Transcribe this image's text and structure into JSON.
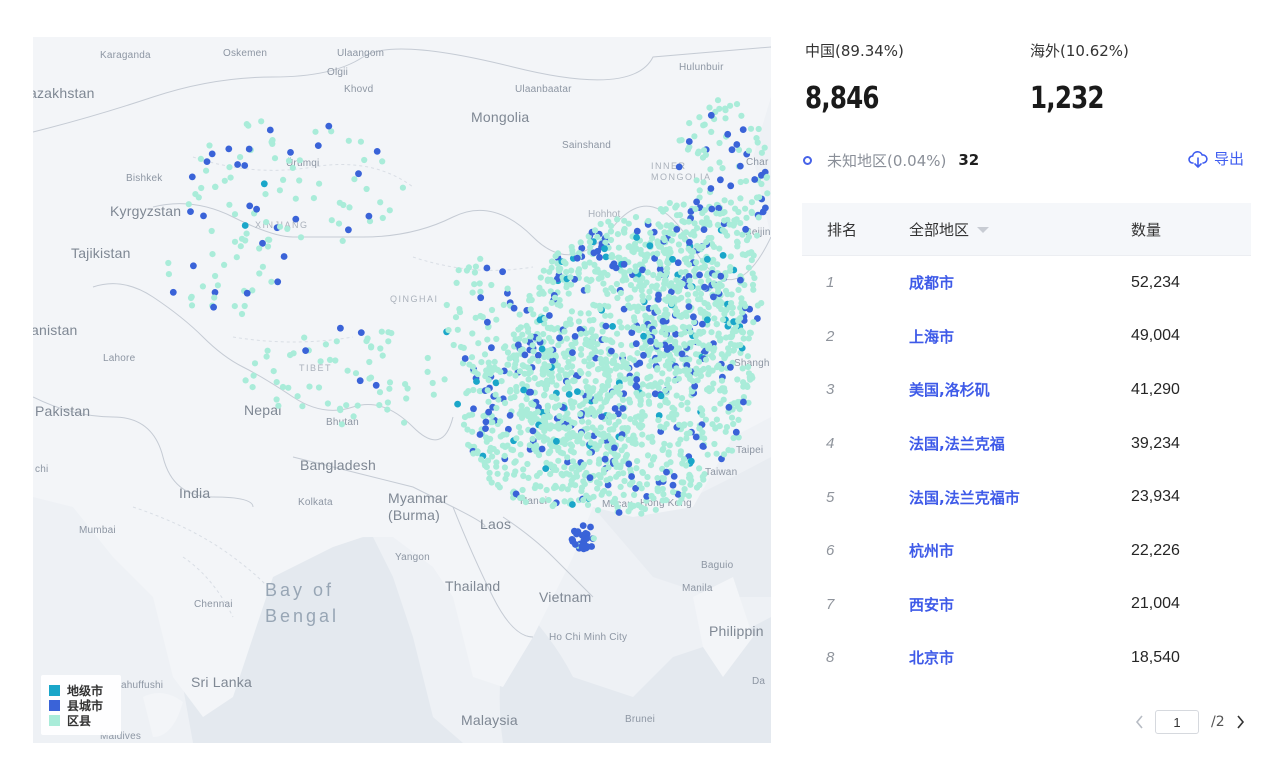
{
  "map": {
    "countries": [
      {
        "label": "azakhstan",
        "cls": "country"
      },
      {
        "label": "Kyrgyzstan",
        "cls": "country"
      },
      {
        "label": "Tajikistan",
        "cls": "country"
      },
      {
        "label": "Mongolia",
        "cls": "country"
      },
      {
        "label": "anistan",
        "cls": "country"
      },
      {
        "label": "Pakistan",
        "cls": "country"
      },
      {
        "label": "Nepal",
        "cls": "country"
      },
      {
        "label": "India",
        "cls": "country"
      },
      {
        "label": "Bangladesh",
        "cls": "country"
      },
      {
        "label": "Myanmar\n(Burma)",
        "cls": "country"
      },
      {
        "label": "Laos",
        "cls": "country"
      },
      {
        "label": "Thailand",
        "cls": "country"
      },
      {
        "label": "Vietnam",
        "cls": "country"
      },
      {
        "label": "Sri Lanka",
        "cls": "country"
      },
      {
        "label": "Malaysia",
        "cls": "country"
      },
      {
        "label": "Philippin",
        "cls": "country"
      }
    ],
    "cities": [
      "Karaganda",
      "Oskemen",
      "Ulaangom",
      "Olgii",
      "Khovd",
      "Ulaanbaatar",
      "Hulunbuir",
      "Sainshand",
      "Bishkek",
      "Ürümqi",
      "Lahore",
      "Bhutan",
      "Kolkata",
      "Mumbai",
      "Chennai",
      "Yangon",
      "Hanoi",
      "Macau",
      "Hong Kong",
      "Taipei",
      "Taiwan",
      "Baguio",
      "Manila",
      "Ho Chi Minh City",
      "Brunei",
      "Shangh",
      "Beijing",
      "ahuffushi",
      "Maldives",
      "Da",
      "Char",
      "chi"
    ],
    "regions": [
      "XINJIANG",
      "QINGHAI",
      "TIBET",
      "INNER MONGOLIA",
      "Hohhot"
    ],
    "sea": "Bay of\nBengal",
    "legend": [
      {
        "label": "地级市",
        "color": "#1aa6c9"
      },
      {
        "label": "县城市",
        "color": "#3a63d8"
      },
      {
        "label": "区县",
        "color": "#a9ecd9"
      }
    ],
    "dot_colors": {
      "prefecture": "#1aa6c9",
      "county": "#3a63d8",
      "district": "#a9ecd9"
    }
  },
  "stats": {
    "china_label": "中国(89.34%)",
    "china_value": "8,846",
    "overseas_label": "海外(10.62%)",
    "overseas_value": "1,232",
    "unknown_label": "未知地区(0.04%)",
    "unknown_value": "32",
    "export_label": "导出"
  },
  "table": {
    "headers": {
      "rank": "排名",
      "region": "全部地区",
      "count": "数量"
    },
    "rows": [
      {
        "rank": "1",
        "region": "成都市",
        "count": "52,234"
      },
      {
        "rank": "2",
        "region": "上海市",
        "count": "49,004"
      },
      {
        "rank": "3",
        "region": "美国,洛杉矶",
        "count": "41,290"
      },
      {
        "rank": "4",
        "region": "法国,法兰克福",
        "count": "39,234"
      },
      {
        "rank": "5",
        "region": "法国,法兰克福市",
        "count": "23,934"
      },
      {
        "rank": "6",
        "region": "杭州市",
        "count": "22,226"
      },
      {
        "rank": "7",
        "region": "西安市",
        "count": "21,004"
      },
      {
        "rank": "8",
        "region": "北京市",
        "count": "18,540"
      }
    ]
  },
  "pager": {
    "current": "1",
    "total": "/2"
  },
  "colors": {
    "accent": "#3e5ae8",
    "header_bg": "#f5f7fa",
    "map_bg": "#eef1f5"
  }
}
